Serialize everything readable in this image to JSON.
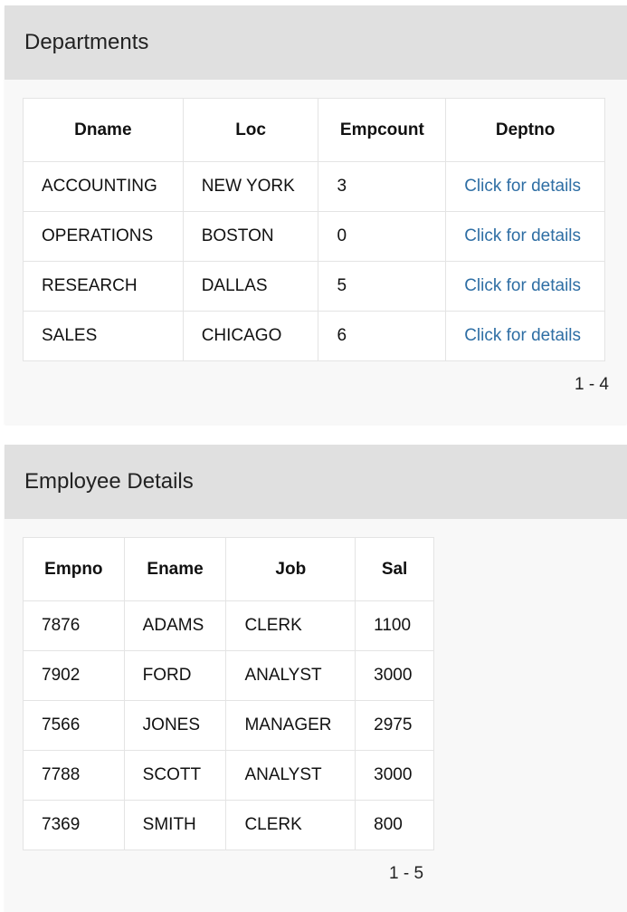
{
  "departments": {
    "title": "Departments",
    "columns": [
      "Dname",
      "Loc",
      "Empcount",
      "Deptno"
    ],
    "rows": [
      {
        "dname": "ACCOUNTING",
        "loc": "NEW YORK",
        "empcount": "3",
        "link": "Click for details"
      },
      {
        "dname": "OPERATIONS",
        "loc": "BOSTON",
        "empcount": "0",
        "link": "Click for details"
      },
      {
        "dname": "RESEARCH",
        "loc": "DALLAS",
        "empcount": "5",
        "link": "Click for details"
      },
      {
        "dname": "SALES",
        "loc": "CHICAGO",
        "empcount": "6",
        "link": "Click for details"
      }
    ],
    "pagination": "1 - 4",
    "link_color": "#2e6ea4"
  },
  "employees": {
    "title": "Employee Details",
    "columns": [
      "Empno",
      "Ename",
      "Job",
      "Sal"
    ],
    "rows": [
      {
        "empno": "7876",
        "ename": "ADAMS",
        "job": "CLERK",
        "sal": "1100"
      },
      {
        "empno": "7902",
        "ename": "FORD",
        "job": "ANALYST",
        "sal": "3000"
      },
      {
        "empno": "7566",
        "ename": "JONES",
        "job": "MANAGER",
        "sal": "2975"
      },
      {
        "empno": "7788",
        "ename": "SCOTT",
        "job": "ANALYST",
        "sal": "3000"
      },
      {
        "empno": "7369",
        "ename": "SMITH",
        "job": "CLERK",
        "sal": "800"
      }
    ],
    "pagination": "1 - 5"
  }
}
